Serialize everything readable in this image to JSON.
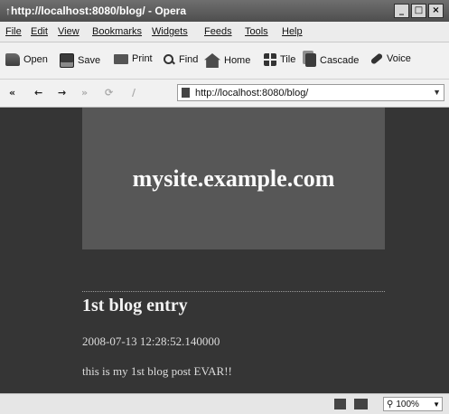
{
  "window": {
    "title": "↑http://localhost:8080/blog/ - Opera",
    "controls": [
      "_",
      "□",
      "×"
    ]
  },
  "menu": [
    "File",
    "Edit",
    "View",
    "Bookmarks",
    "Widgets",
    "Feeds",
    "Tools",
    "Help"
  ],
  "toolbar": [
    {
      "label": "Open",
      "icon": "folder-icon"
    },
    {
      "label": "Save",
      "icon": "save-icon"
    },
    {
      "label": "Print",
      "icon": "printer-icon"
    },
    {
      "label": "Find",
      "icon": "find-icon"
    },
    {
      "label": "Home",
      "icon": "home-icon"
    },
    {
      "label": "Tile",
      "icon": "tile-icon"
    },
    {
      "label": "Cascade",
      "icon": "cascade-icon"
    },
    {
      "label": "Voice",
      "icon": "voice-icon"
    }
  ],
  "navigation": {
    "buttons": [
      "«",
      "←",
      "→",
      "»",
      "⟳",
      "∕"
    ],
    "url": "http://localhost:8080/blog/"
  },
  "page": {
    "site_name": "mysite.example.com",
    "post": {
      "title": "1st blog entry",
      "date": "2008-07-13 12:28:52.140000",
      "body": "this is my 1st blog post EVAR!!"
    }
  },
  "statusbar": {
    "zoom": "100%"
  }
}
